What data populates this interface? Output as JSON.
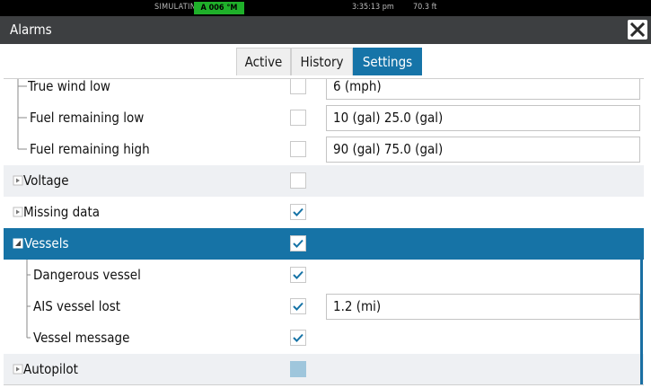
{
  "status": {
    "simulating": "SIMULATING...",
    "badge": "A 006 °M",
    "time": "3:35:13 pm",
    "depth": "70.3 ft",
    "badge_color": "#1fb02a"
  },
  "window": {
    "title": "Alarms",
    "close_icon": "close-icon"
  },
  "tabs": [
    {
      "label": "Active"
    },
    {
      "label": "History"
    },
    {
      "label": "Settings"
    }
  ],
  "rows": [
    {
      "label": "True wind low",
      "checked": false,
      "value": "6 (mph)"
    },
    {
      "label": "Fuel remaining low",
      "checked": false,
      "value": "10 (gal)  25.0 (gal)"
    },
    {
      "label": "Fuel remaining high",
      "checked": false,
      "value": "90 (gal)  75.0 (gal)"
    },
    {
      "label": "Voltage",
      "checked": false,
      "value": ""
    },
    {
      "label": "Missing data",
      "checked": true,
      "value": ""
    },
    {
      "label": "Vessels",
      "checked": true,
      "value": ""
    },
    {
      "label": "Dangerous vessel",
      "checked": true,
      "value": ""
    },
    {
      "label": "AIS vessel lost",
      "checked": true,
      "value": "1.2 (mi)"
    },
    {
      "label": "Vessel message",
      "checked": true,
      "value": ""
    },
    {
      "label": "Autopilot",
      "checked": false,
      "value": ""
    }
  ],
  "colors": {
    "accent": "#1673a6",
    "titlebar": "#3d3f41",
    "alt_row": "#eef0f3"
  }
}
